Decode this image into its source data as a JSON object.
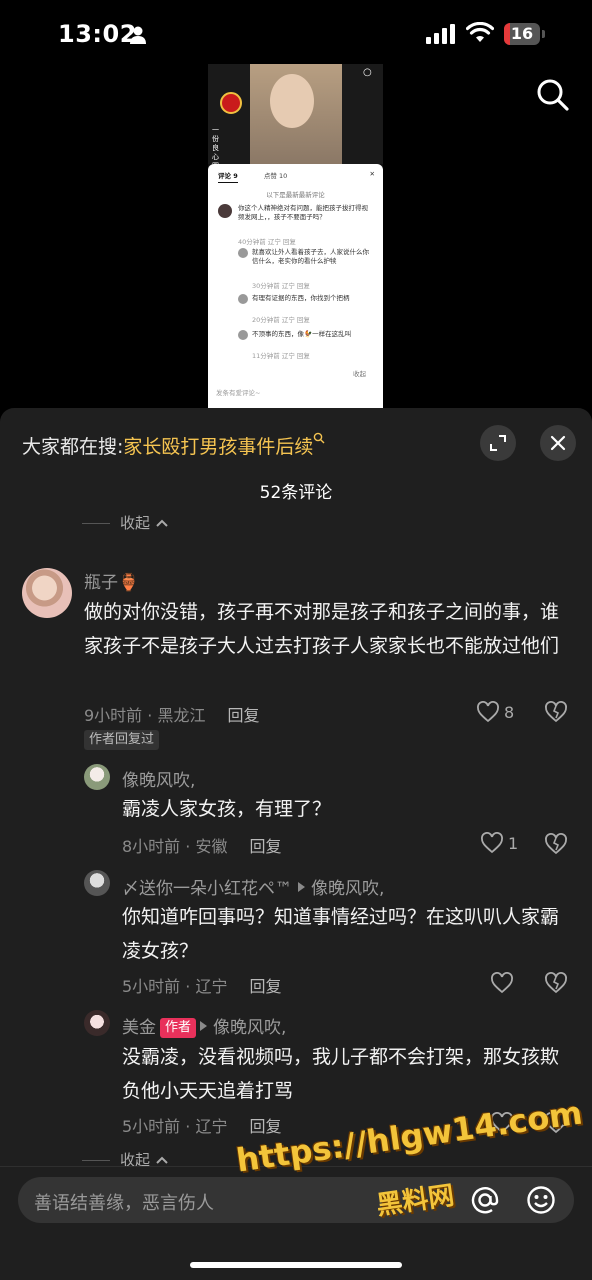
{
  "status_bar": {
    "time": "13:02",
    "battery": "16",
    "battery_level": 0.16
  },
  "preview": {
    "side_text": "一份良心图",
    "tabs": [
      "评论 9",
      "点赞 10"
    ],
    "hint": "以下是最新最新评论",
    "comments": [
      {
        "text": "你这个人精神绝对有问题，能把孩子拔打得视频发网上，，孩子不要面子吗？",
        "meta": "40分钟前 辽宁  回复"
      },
      {
        "text": "就喜欢让外人看着孩子去，人家说什么你信什么，老实你的看什么护犊",
        "meta": "30分钟前 辽宁  回复"
      },
      {
        "text": "有理有证据的东西，你找到个把柄",
        "meta": "20分钟前 辽宁  回复"
      },
      {
        "text": "不顶事的东西，像🐓一样在这乱叫",
        "meta": "11分钟前 辽宁  回复"
      }
    ],
    "collapse": "收起",
    "input": "发条有爱评论~"
  },
  "header": {
    "search_prefix": "大家都在搜:",
    "search_keyword": "家长殴打男孩事件后续",
    "comment_count": "52条评论"
  },
  "collapse_label": "收起",
  "comments": {
    "main": {
      "username": "瓶子🏺",
      "text": "做的对你没错，孩子再不对那是孩子和孩子之间的事，谁家孩子不是孩子大人过去打孩子人家家长也不能放过他们",
      "meta": "9小时前 · 黑龙江",
      "reply": "回复",
      "likes": "8",
      "badge": "作者回复过"
    },
    "replies": [
      {
        "username": "像晚风吹,",
        "text": "霸凌人家女孩，有理了？",
        "meta": "8小时前 · 安徽",
        "reply": "回复",
        "likes": "1"
      },
      {
        "username": "〆送你一朵小红花ペ™",
        "reply_to": "像晚风吹,",
        "text": "你知道咋回事吗？知道事情经过吗？在这叭叭人家霸凌女孩？",
        "meta": "5小时前 · 辽宁",
        "reply": "回复"
      },
      {
        "username": "美金",
        "tag": "作者",
        "reply_to": "像晚风吹,",
        "text": "没霸凌，没看视频吗，我儿子都不会打架，那女孩欺负他小天天追着打骂",
        "meta": "5小时前 · 辽宁",
        "reply": "回复"
      }
    ]
  },
  "input": {
    "placeholder": "善语结善缘，恶言伤人"
  },
  "watermark": {
    "url": "https://hlgw14.com",
    "brand": "黑料网"
  }
}
